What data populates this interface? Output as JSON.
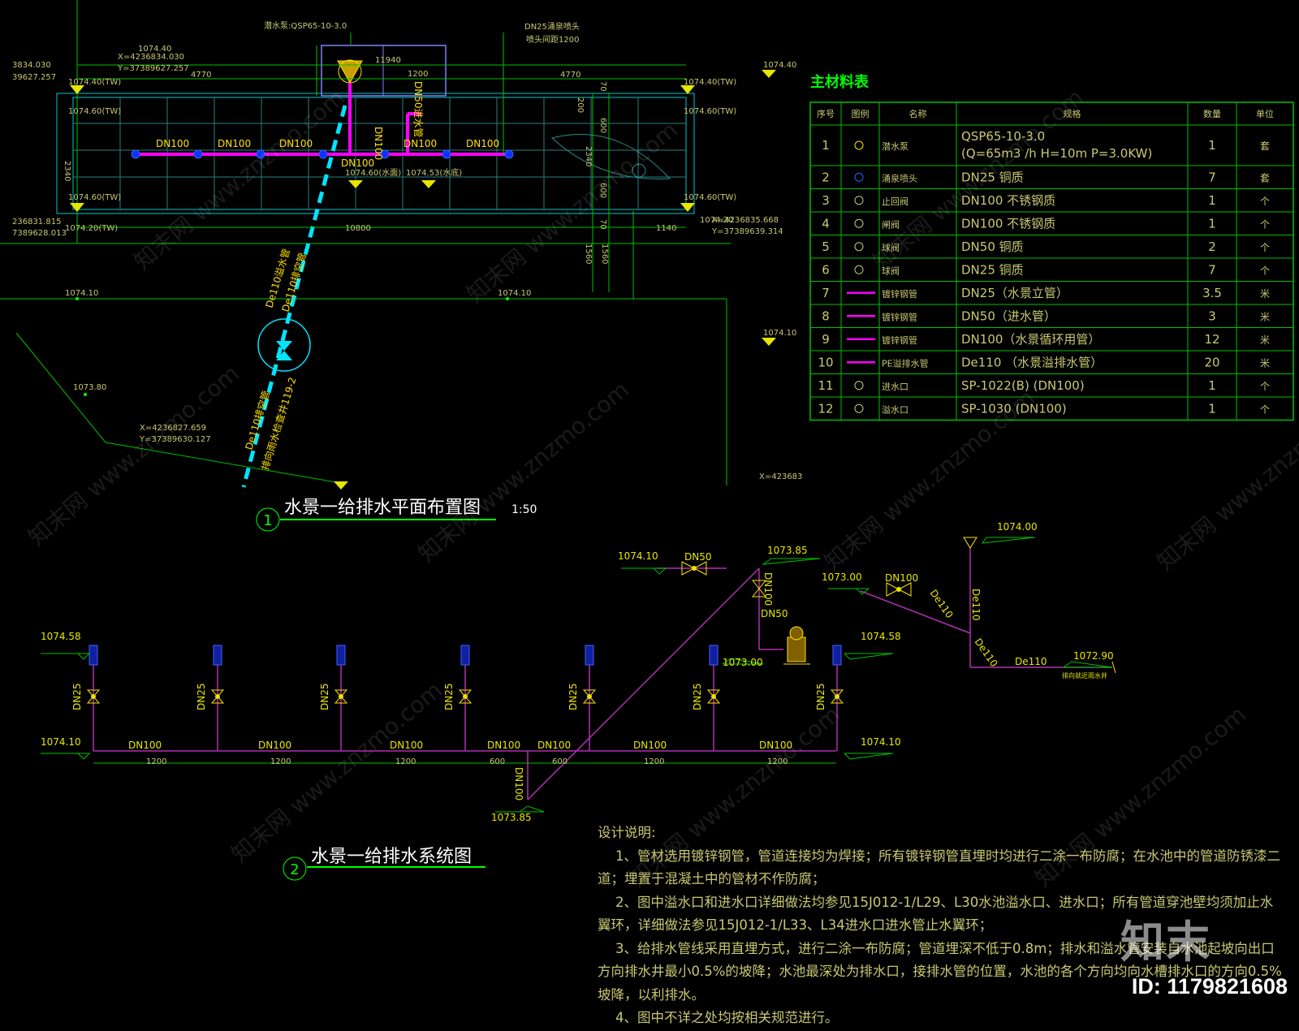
{
  "plan": {
    "title": "水景一给排水平面布置图",
    "index": "1",
    "scale": "1:50",
    "pump_label": "潜水泵:QSP65-10-3.0",
    "nozzle_label": "DN25涌泉喷头",
    "nozzle_spacing": "喷头间距1200",
    "dims": {
      "left": "4770",
      "mid": "11940",
      "right": "4770",
      "inner": "1200",
      "bottom": "10800",
      "bottom_right": "1140",
      "height": "2340",
      "d600a": "600",
      "d600b": "600",
      "d200": "200",
      "d70a": "70",
      "d70b": "70",
      "d1560a": "1560",
      "d1560b": "1560",
      "d2340": "2340"
    },
    "pipes": [
      "DN100",
      "DN100",
      "DN100",
      "DN100",
      "DN100",
      "DN100"
    ],
    "pipe_center": "DN100",
    "pipe_center_v": "DN100",
    "inlet_v": "DN50进水管",
    "drain1": "De110溢水管",
    "drain2": "De110排空管",
    "drain3": "De110排空管",
    "drain4": "排向雨水检查井119-2",
    "lev": {
      "l1": "1074.40",
      "l2": "1074.40(TW)",
      "l3": "1074.60(TW)",
      "l4": "1074.40(TW)",
      "l5": "1074.60(TW)",
      "l6": "1074.60(TW)",
      "l7": "1074.60(TW)",
      "l8": "1074.20(TW)",
      "l9": "1074.20",
      "l10": "1074.40",
      "l11": "1074.10",
      "l12": "1074.10",
      "l13": "1074.10",
      "l14": "1073.80",
      "l15": "1074.60(水面)",
      "l16": "1074.53(水底)"
    },
    "coords": {
      "c1": "X=4236834.030",
      "c2": "Y=37389627.257",
      "c3": "3834.030",
      "c4": "39627.257",
      "c5": "236831.815",
      "c6": "7389628.013",
      "c7": "X=4236835.668",
      "c8": "Y=37389639.314",
      "c9": "X=4236827.659",
      "c10": "Y=37389630.127",
      "c11": "X=423683"
    }
  },
  "system": {
    "title": "水景一给排水系统图",
    "index": "2",
    "risers": [
      "DN25",
      "DN25",
      "DN25",
      "DN25",
      "DN25",
      "DN25",
      "DN25"
    ],
    "main": [
      "DN100",
      "DN100",
      "DN100",
      "DN100",
      "DN100",
      "DN100",
      "DN100"
    ],
    "spacing": [
      "1200",
      "1200",
      "1200",
      "600",
      "600",
      "1200",
      "1200"
    ],
    "lev": {
      "a": "1074.58",
      "b": "1074.10",
      "c": "1073.85",
      "d": "1074.58",
      "e": "1074.10",
      "f": "1074.10",
      "g": "1073.85",
      "h": "1073.00",
      "i": "1073.00",
      "j": "1074.00",
      "k": "1072.90"
    },
    "labels": {
      "dn50a": "DN50",
      "dn100v": "DN100",
      "dn50b": "DN50",
      "dn100c": "DN100",
      "de110a": "De110",
      "de110b": "De110",
      "de110c": "De110",
      "de110d": "De110",
      "dn100low": "DN100",
      "outfall": "排向就近雨水井"
    }
  },
  "materials": {
    "title": "主材料表",
    "headers": [
      "序号",
      "图例",
      "名称",
      "规格",
      "数量",
      "单位"
    ],
    "rows": [
      {
        "no": "1",
        "name": "潜水泵",
        "spec": "QSP65-10-3.0",
        "spec2": "(Q=65m3 /h H=10m P=3.0KW)",
        "qty": "1",
        "unit": "套"
      },
      {
        "no": "2",
        "name": "涌泉喷头",
        "spec": "DN25 铜质",
        "qty": "7",
        "unit": "套"
      },
      {
        "no": "3",
        "name": "止回阀",
        "spec": "DN100 不锈钢质",
        "qty": "1",
        "unit": "个"
      },
      {
        "no": "4",
        "name": "闸阀",
        "spec": "DN100 不锈钢质",
        "qty": "1",
        "unit": "个"
      },
      {
        "no": "5",
        "name": "球阀",
        "spec": "DN50 铜质",
        "qty": "2",
        "unit": "个"
      },
      {
        "no": "6",
        "name": "球阀",
        "spec": "DN25 铜质",
        "qty": "7",
        "unit": "个"
      },
      {
        "no": "7",
        "name": "镀锌钢管",
        "spec": "DN25（水景立管）",
        "qty": "3.5",
        "unit": "米"
      },
      {
        "no": "8",
        "name": "镀锌钢管",
        "spec": "DN50（进水管）",
        "qty": "3",
        "unit": "米"
      },
      {
        "no": "9",
        "name": "镀锌钢管",
        "spec": "DN100（水景循环用管）",
        "qty": "12",
        "unit": "米"
      },
      {
        "no": "10",
        "name": "PE溢排水管",
        "spec": "De110 （水景溢排水管）",
        "qty": "20",
        "unit": "米"
      },
      {
        "no": "11",
        "name": "进水口",
        "spec": "SP-1022(B) (DN100)",
        "qty": "1",
        "unit": "个"
      },
      {
        "no": "12",
        "name": "溢水口",
        "spec": "SP-1030 (DN100)",
        "qty": "1",
        "unit": "个"
      }
    ]
  },
  "notes": {
    "title": "设计说明:",
    "items": [
      "1、管材选用镀锌钢管，管道连接均为焊接；所有镀锌钢管直埋时均进行二涂一布防腐；在水池中的管道防锈漆二道；埋置于混凝土中的管材不作防腐；",
      "2、图中溢水口和进水口详细做法均参见15J012-1/L29、L30水池溢水口、进水口；所有管道穿池壁均须加止水翼环，详细做法参见15J012-1/L33、L34进水口进水管止水翼环；",
      "3、给排水管线采用直埋方式，进行二涂一布防腐；管道埋深不低于0.8m；排水和溢水管安装自水池起坡向出口方向排水井最小0.5%的坡降；水池最深处为排水口，接排水管的位置，水池的各个方向均向水槽排水口的方向0.5%坡降，以利排水。",
      "4、图中不详之处均按相关规范进行。"
    ]
  },
  "watermark": "知末网 www.znzmo.com",
  "brand": "知末",
  "id_label": "ID: 1179821608",
  "colors": {
    "bg": "#000000",
    "pipe": "#ff00ff",
    "grid": "#00c8c8",
    "green": "#00ff00",
    "yellow": "#e6e600",
    "drain": "#00e5ff",
    "text": "#c8c873",
    "system_pipe": "#b030b0"
  }
}
